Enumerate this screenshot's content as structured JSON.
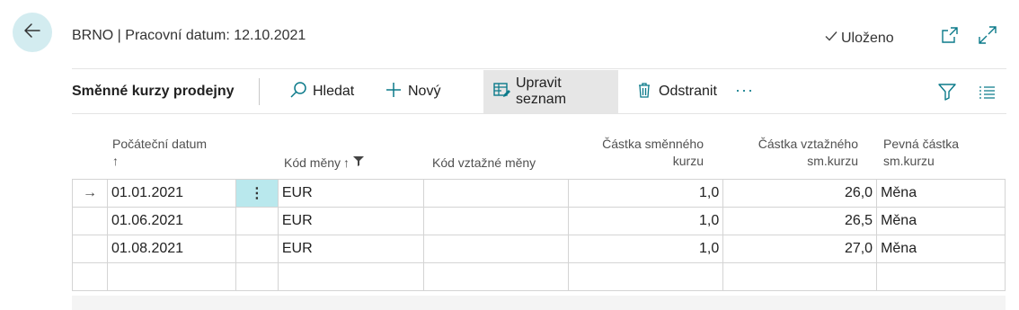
{
  "header": {
    "title": "BRNO | Pracovní datum: 12.10.2021",
    "saved_label": "Uloženo"
  },
  "toolbar": {
    "page_caption": "Směnné kurzy prodejny",
    "search_label": "Hledat",
    "new_label": "Nový",
    "edit_list_label": "Upravit seznam",
    "delete_label": "Odstranit",
    "more_label": "···"
  },
  "columns": {
    "start_date": "Počáteční datum",
    "start_date_sort": "↑",
    "currency_code": "Kód měny",
    "currency_code_sort": "↑",
    "relational_currency": "Kód vztažné měny",
    "exchange_amount_1": "Částka směnného",
    "exchange_amount_2": "kurzu",
    "relational_amount_1": "Částka vztažného",
    "relational_amount_2": "sm.kurzu",
    "fixed_amount_1": "Pevná částka",
    "fixed_amount_2": "sm.kurzu"
  },
  "rows": [
    {
      "indicator": "→",
      "menu": "⋮",
      "start_date": "01.01.2021",
      "currency": "EUR",
      "relational_currency": "",
      "exchange_amount": "1,0",
      "relational_amount": "26,0",
      "fixed": "Měna"
    },
    {
      "indicator": "",
      "menu": "",
      "start_date": "01.06.2021",
      "currency": "EUR",
      "relational_currency": "",
      "exchange_amount": "1,0",
      "relational_amount": "26,5",
      "fixed": "Měna"
    },
    {
      "indicator": "",
      "menu": "",
      "start_date": "01.08.2021",
      "currency": "EUR",
      "relational_currency": "",
      "exchange_amount": "1,0",
      "relational_amount": "27,0",
      "fixed": "Měna"
    }
  ],
  "icons": {
    "back": "arrow-left-icon",
    "saved": "check-icon",
    "open_new": "open-in-new-window-icon",
    "expand": "expand-icon",
    "search": "search-icon",
    "new": "plus-icon",
    "edit_list": "edit-list-icon",
    "delete": "trash-icon",
    "filter": "filter-icon",
    "list": "list-icon",
    "filter_column": "filter-funnel-icon"
  },
  "colors": {
    "accent": "#0b7a8a",
    "back_bg": "#d3ecf0",
    "selected_cell": "#b9e8ed"
  }
}
